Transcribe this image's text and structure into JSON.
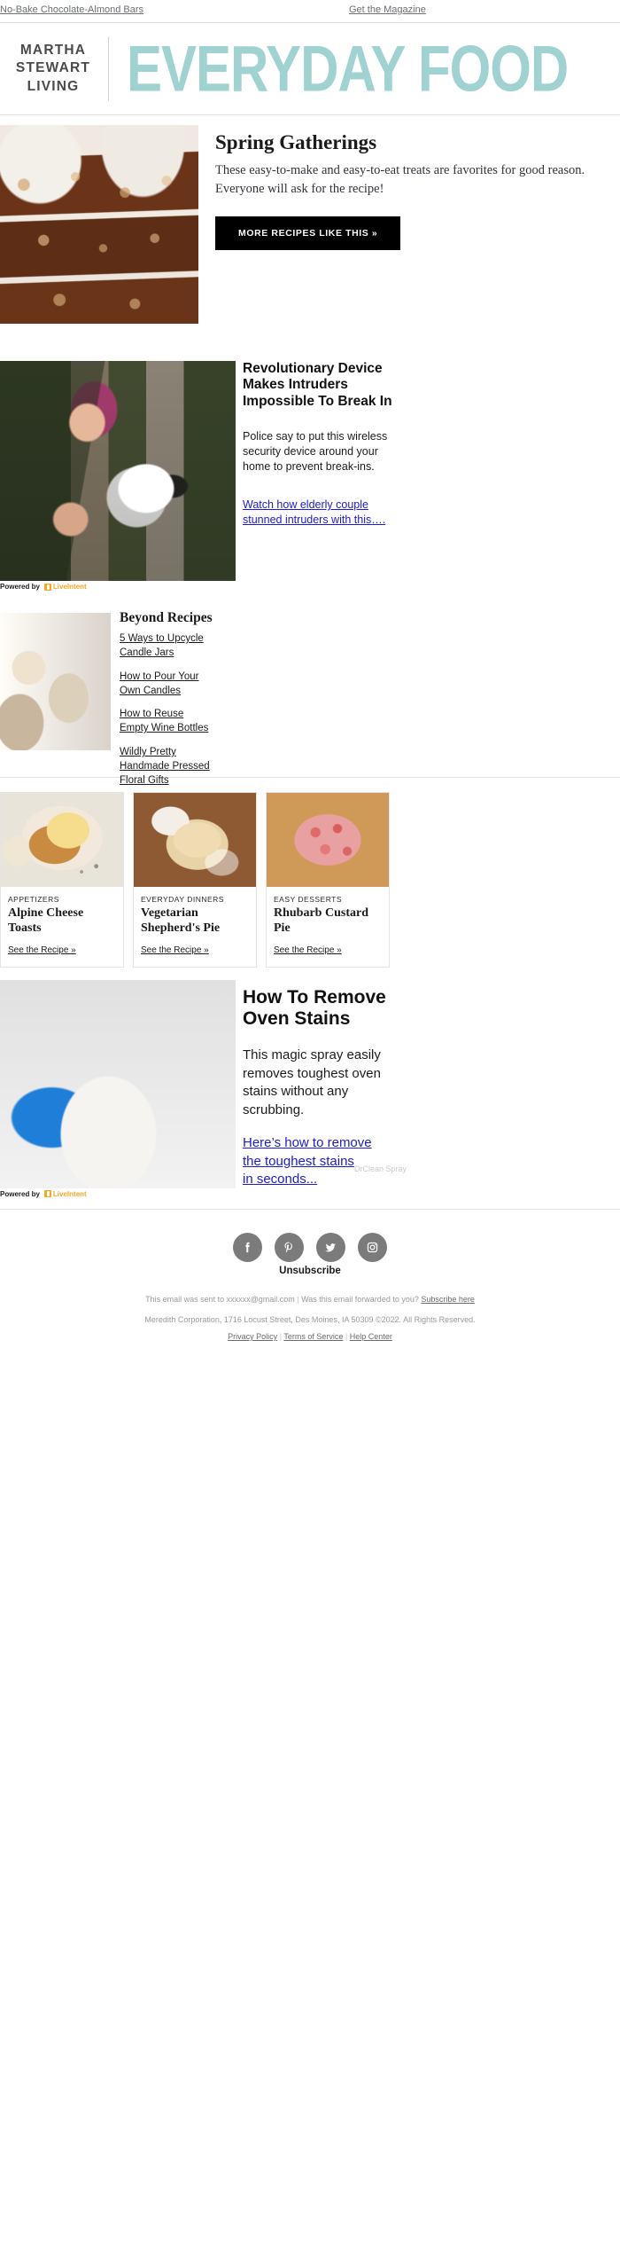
{
  "preheader": {
    "left_link": "No-Bake Chocolate-Almond Bars",
    "right_link": "Get the Magazine"
  },
  "masthead": {
    "brand_line1": "MARTHA",
    "brand_line2": "STEWART",
    "brand_line3": "LIVING",
    "publication": "EVERYDAY FOOD",
    "publication_color": "#9fd2d0"
  },
  "hero": {
    "title": "Spring Gatherings",
    "body": "These easy-to-make and easy-to-eat treats are favorites for good reason. Everyone will ask for the recipe!",
    "cta": "MORE RECIPES LIKE THIS »",
    "image_alt": "no-bake chocolate almond bars"
  },
  "ad_security": {
    "headline_line1": "Revolutionary Device",
    "headline_line2": "Makes Intruders",
    "headline_line3": "Impossible To Break In",
    "body": "Police say to put this wireless security device around your home to prevent break-ins.",
    "link_line1": "Watch how elderly couple",
    "link_line2": "stunned intruders with this….",
    "powered_by": "Powered by",
    "network": "LiveIntent",
    "link_color": "#1b1bd6",
    "image_alt": "hands mounting a wireless security camera on a fence post"
  },
  "beyond": {
    "title": "Beyond Recipes",
    "links": [
      "5 Ways to Upcycle Candle Jars",
      "How to Pour Your Own Candles",
      "How to Reuse Empty Wine Bottles",
      "Wildly Pretty Handmade Pressed Floral Gifts"
    ],
    "image_alt": "glass candle jars on a tray"
  },
  "cards": [
    {
      "kicker": "APPETIZERS",
      "title": "Alpine Cheese Toasts",
      "cta": "See the Recipe »",
      "image_alt": "melted cheese toast on a speckled plate"
    },
    {
      "kicker": "EVERYDAY DINNERS",
      "title": "Vegetarian Shepherd's Pie",
      "cta": "See the Recipe »",
      "image_alt": "vegetarian shepherd's pie in an oval baking dish"
    },
    {
      "kicker": "EASY DESSERTS",
      "title": "Rhubarb Custard Pie",
      "cta": "See the Recipe »",
      "image_alt": "rhubarb custard pie in a crimped crust"
    }
  ],
  "ad_oven": {
    "headline_line1": "How To Remove",
    "headline_line2": "Oven Stains",
    "body_line1": "This magic spray easily",
    "body_line2": "removes toughest oven",
    "body_line3": "stains without any",
    "body_line4": "scrubbing.",
    "link_line1": "Here’s how to remove",
    "link_line2": "the toughest stains",
    "link_line3": "in seconds...",
    "powered_by": "Powered by",
    "network": "LiveIntent",
    "advertiser": "DrClean Spray",
    "link_color": "#1b1bd6",
    "image_alt": "gloved hand scrubbing foam on an oven tray"
  },
  "footer": {
    "social": [
      {
        "name": "facebook-icon",
        "label": "Facebook"
      },
      {
        "name": "pinterest-icon",
        "label": "Pinterest"
      },
      {
        "name": "twitter-icon",
        "label": "Twitter"
      },
      {
        "name": "instagram-icon",
        "label": "Instagram"
      }
    ],
    "unsubscribe": "Unsubscribe",
    "sent_to": "This email was sent to xxxxxx@gmail.com",
    "forwarded_q": "Was this email forwarded to you?",
    "subscribe_here": "Subscribe here",
    "address": "Meredith Corporation, 1716 Locust Street, Des Moines, IA 50309 ©2022. All Rights Reserved.",
    "privacy": "Privacy Policy",
    "terms": "Terms of Service",
    "help": "Help Center",
    "separator": "|"
  }
}
